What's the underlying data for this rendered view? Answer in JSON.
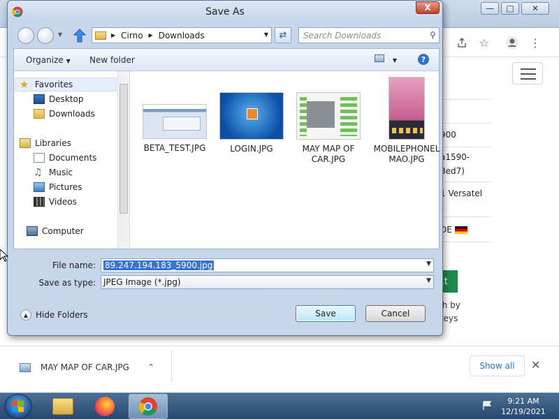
{
  "dialog": {
    "title": "Save As",
    "close_label": "X",
    "breadcrumb": [
      "Cirno",
      "Downloads"
    ],
    "search_placeholder": "Search Downloads",
    "commands": {
      "organize": "Organize",
      "new_folder": "New folder"
    },
    "nav": {
      "favorites_label": "Favorites",
      "favorites": [
        "Desktop",
        "Downloads"
      ],
      "libraries_label": "Libraries",
      "libraries": [
        "Documents",
        "Music",
        "Pictures",
        "Videos"
      ],
      "computer_label": "Computer"
    },
    "files": [
      {
        "name": "BETA_TEST.JPG",
        "icon": "screenshot-thumbnail"
      },
      {
        "name": "LOGIN.JPG",
        "icon": "windows-login-thumbnail"
      },
      {
        "name": "MAY MAP OF CAR.JPG",
        "icon": "diagram-thumbnail"
      },
      {
        "name": "MOBILEPHONELMAO.JPG",
        "icon": "phone-screenshot-thumbnail"
      }
    ],
    "file_name_label": "File name:",
    "file_name_value": "89.247.194.183_5900.jpg",
    "save_as_type_label": "Save as type:",
    "save_as_type_value": "JPEG Image (*.jpg)",
    "hide_folders_label": "Hide Folders",
    "save_label": "Save",
    "cancel_label": "Cancel"
  },
  "background": {
    "cells": [
      "900",
      "a1590-",
      "8ed7)",
      "1 Versatel",
      "DE"
    ],
    "next_button_fragment": "xt",
    "footnote_fragment": [
      "th by",
      "keys"
    ]
  },
  "download_shelf": {
    "item_name": "MAY MAP OF CAR.JPG",
    "show_all_label": "Show all"
  },
  "taskbar": {
    "time": "9:21 AM",
    "date": "12/19/2021"
  },
  "colors": {
    "dialog_frame": "#c7d6ea",
    "selection_blue": "#3375d6",
    "taskbar": "#27486e",
    "next_button_green": "#1e8a4c",
    "show_all_blue": "#1a73e8"
  }
}
